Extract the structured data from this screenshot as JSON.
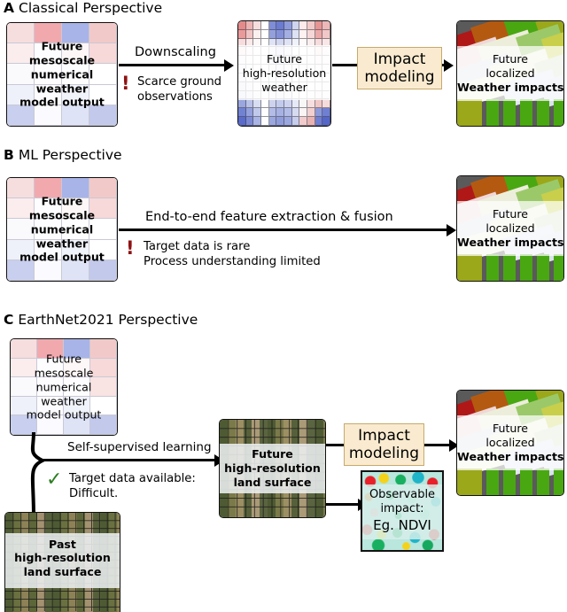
{
  "figure": {
    "panels": [
      {
        "letter": "A",
        "title": "Classical Perspective",
        "source_box": {
          "lines": [
            "Future",
            "mesoscale",
            "numerical",
            "weather",
            "model output"
          ]
        },
        "arrow1_label": "Downscaling",
        "warning1": {
          "icon": "exclamation-icon",
          "lines": [
            "Scarce ground",
            "observations"
          ],
          "color": "#8f1212"
        },
        "mid_box": {
          "lines": [
            "Future",
            "high-resolution",
            "weather"
          ]
        },
        "process_box": {
          "lines": [
            "Impact",
            "modeling"
          ],
          "color": "#faebd0"
        },
        "target_box": {
          "lines": [
            "Future",
            "localized",
            "Weather impacts"
          ]
        }
      },
      {
        "letter": "B",
        "title": "ML Perspective",
        "source_box": {
          "lines": [
            "Future",
            "mesoscale",
            "numerical",
            "weather",
            "model output"
          ]
        },
        "arrow1_label": "End-to-end feature extraction & fusion",
        "warning1": {
          "icon": "exclamation-icon",
          "lines": [
            "Target data is rare",
            "Process understanding limited"
          ],
          "color": "#8f1212"
        },
        "target_box": {
          "lines": [
            "Future",
            "localized",
            "Weather impacts"
          ]
        }
      },
      {
        "letter": "C",
        "title": "EarthNet2021 Perspective",
        "source_box": {
          "lines": [
            "Future",
            "mesoscale",
            "numerical",
            "weather",
            "model output"
          ]
        },
        "past_box": {
          "lines": [
            "Past",
            "high-resolution",
            "land surface"
          ]
        },
        "arrow1_label": "Self-supervised learning",
        "note1": {
          "icon": "check-icon",
          "lines": [
            "Target data available:",
            "Difficult."
          ],
          "color": "#2e7d22"
        },
        "mid_box": {
          "lines": [
            "Future",
            "high-resolution",
            "land surface"
          ]
        },
        "process_box": {
          "lines": [
            "Impact",
            "modeling"
          ],
          "color": "#faebd0"
        },
        "target_box": {
          "lines": [
            "Future",
            "localized",
            "Weather impacts"
          ]
        },
        "ndvi_box": {
          "lines": [
            "Observable",
            "impact:",
            "Eg. NDVI"
          ]
        }
      }
    ]
  }
}
